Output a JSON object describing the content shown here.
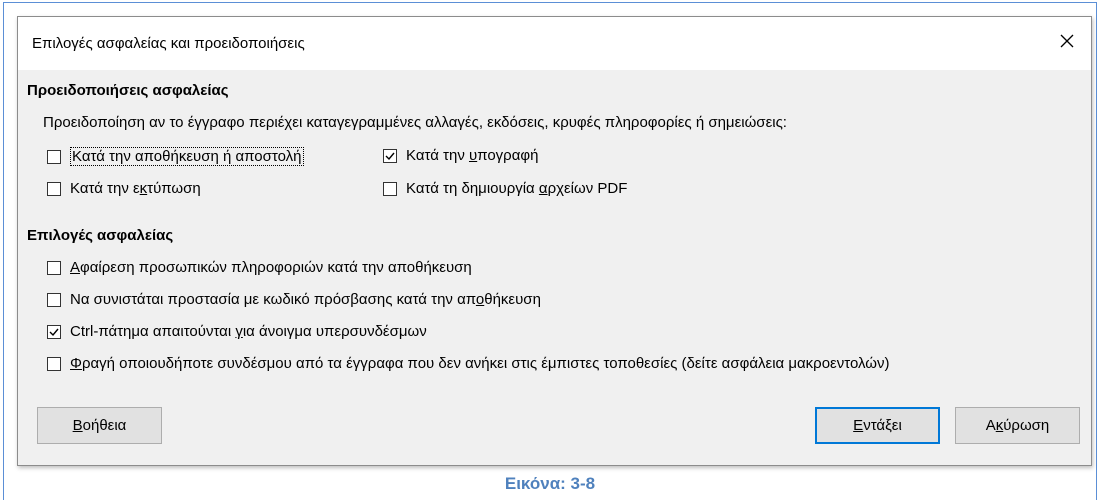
{
  "dialog": {
    "title": "Επιλογές ασφαλείας και προειδοποιήσεις"
  },
  "warnings": {
    "heading": "Προειδοποιήσεις ασφαλείας",
    "description": "Προειδοποίηση αν το έγγραφο περιέχει καταγεγραμμένες αλλαγές, εκδόσεις, κρυφές πληροφορίες ή σημειώσεις:",
    "options": [
      {
        "pre": "Κατά την αποθήκευση ή αποστολή",
        "u": "",
        "post": "",
        "checked": false
      },
      {
        "pre": "Κατά την ",
        "u": "υ",
        "post": "πογραφή",
        "checked": true
      },
      {
        "pre": "Κατά την ε",
        "u": "κ",
        "post": "τύπωση",
        "checked": false
      },
      {
        "pre": "Κατά τη δημιουργία ",
        "u": "α",
        "post": "ρχείων PDF",
        "checked": false
      }
    ]
  },
  "options": {
    "heading": "Επιλογές ασφαλείας",
    "items": [
      {
        "pre": "",
        "u": "Α",
        "post": "φαίρεση προσωπικών πληροφοριών κατά την αποθήκευση",
        "checked": false
      },
      {
        "pre": "Να συνιστάται προστασία με κωδικό πρόσβασης κατά την απ",
        "u": "ο",
        "post": "θήκευση",
        "checked": false
      },
      {
        "pre": "Ctrl-πάτημα απαιτούνται ",
        "u": "γ",
        "post": "ια άνοιγμα υπερσυνδέσμων",
        "checked": true
      },
      {
        "pre": "",
        "u": "Φ",
        "post": "ραγή οποιουδήποτε συνδέσμου από τα έγγραφα που δεν ανήκει στις έμπιστες τοποθεσίες (δείτε ασφάλεια μακροεντολών)",
        "checked": false
      }
    ]
  },
  "buttons": {
    "help": {
      "u": "Β",
      "post": "οήθεια"
    },
    "ok": {
      "u": "Ε",
      "post": "ντάξει"
    },
    "cancel": {
      "pre": "Α",
      "u": "κ",
      "post": "ύρωση"
    }
  },
  "caption": "Εικόνα: 3-8",
  "colors": {
    "caption": "#4f81bd",
    "default_button_border": "#0078d7",
    "frame": "#5b8fd6"
  }
}
